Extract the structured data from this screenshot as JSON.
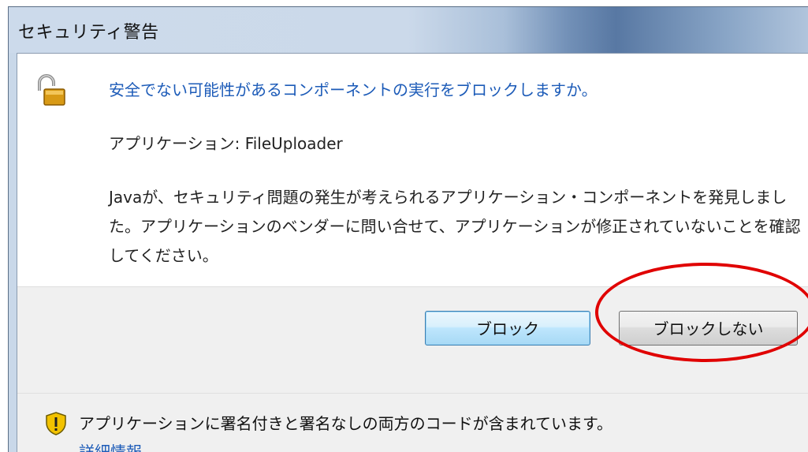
{
  "window": {
    "title": "セキュリティ警告"
  },
  "main": {
    "heading": "安全でない可能性があるコンポーネントの実行をブロックしますか。",
    "application_line": "アプリケーション: FileUploader",
    "description": "Javaが、セキュリティ問題の発生が考えられるアプリケーション・コンポーネントを発見しました。アプリケーションのベンダーに問い合せて、アプリケーションが修正されていないことを確認してください。",
    "icon": "unlocked-padlock-icon"
  },
  "buttons": {
    "block_label": "ブロック",
    "dont_block_label": "ブロックしない"
  },
  "footer": {
    "icon": "warning-shield-icon",
    "message": "アプリケーションに署名付きと署名なしの両方のコードが含まれています。",
    "details_link": "詳細情報"
  },
  "colors": {
    "heading": "#1c5bb8",
    "annotation_circle": "#e00000",
    "shield": "#f2c200"
  }
}
